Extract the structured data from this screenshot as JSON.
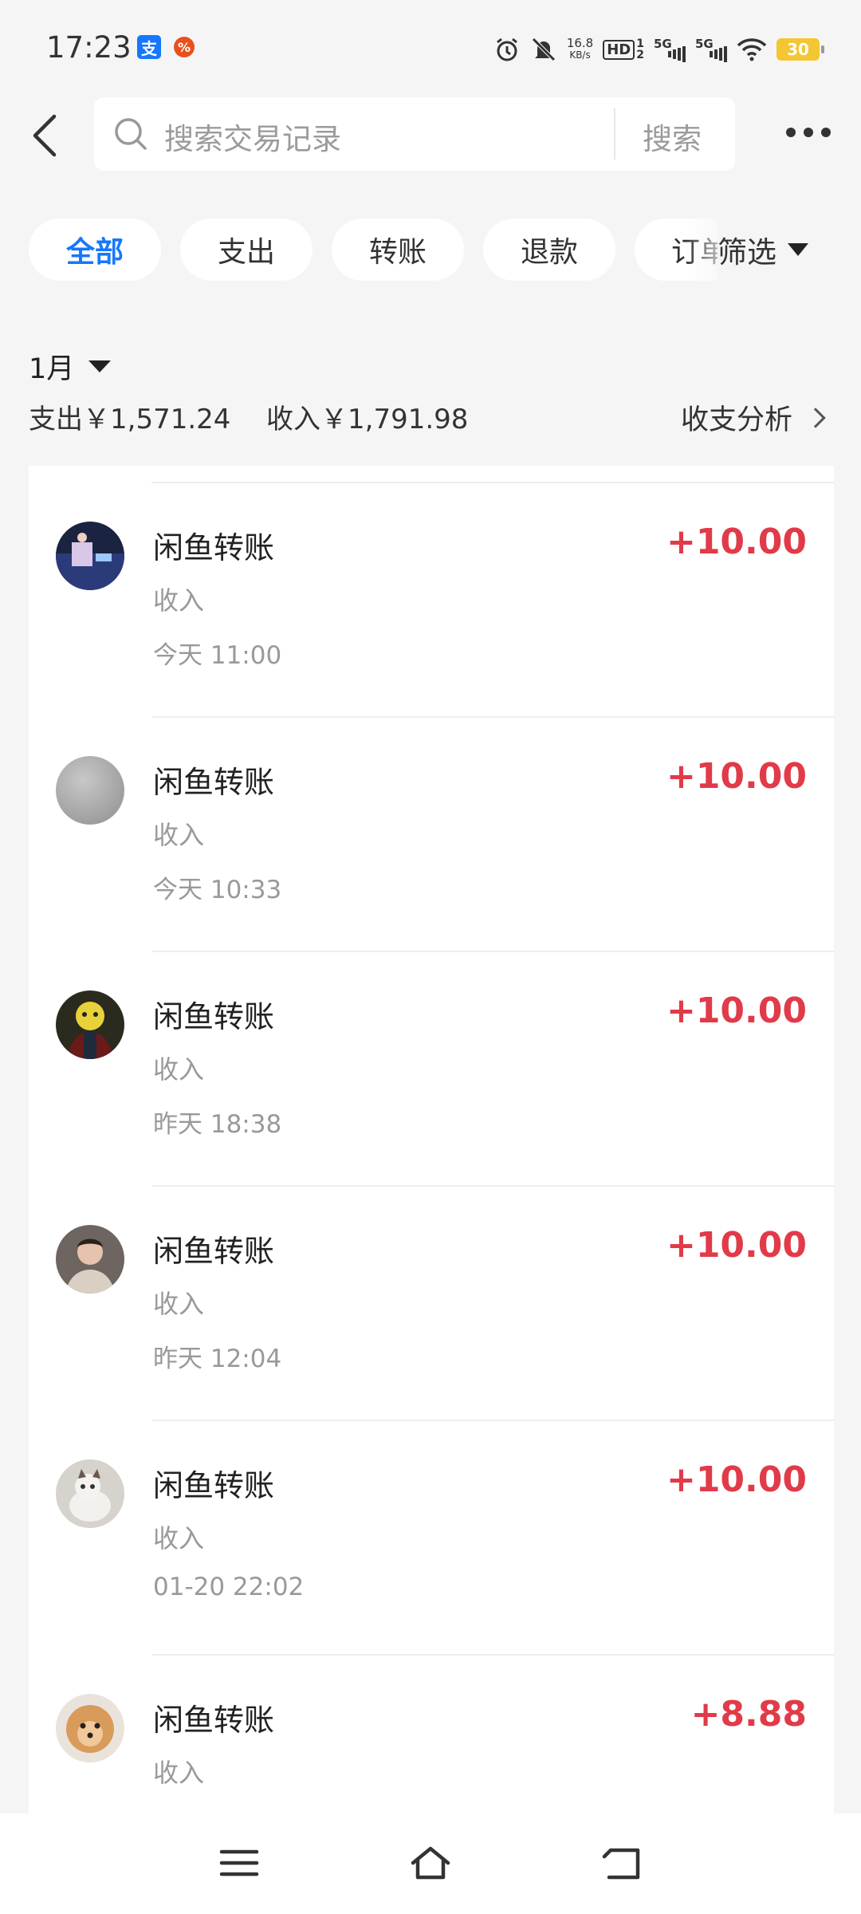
{
  "status": {
    "time": "17:23",
    "apps": [
      {
        "name": "alipay-app-icon",
        "glyph": "支",
        "color": "#1677ff"
      },
      {
        "name": "app-notification-icon",
        "glyph": "%",
        "color": "#e8501d"
      }
    ],
    "net_speed_value": "16.8",
    "net_speed_unit": "KB/s",
    "hd_label": "HD",
    "hd_sub_top": "1",
    "hd_sub_bottom": "2",
    "sim1": "5G",
    "sim2": "5G",
    "battery": "30"
  },
  "search": {
    "placeholder": "搜索交易记录",
    "button": "搜索"
  },
  "tabs": [
    {
      "label": "全部",
      "active": true
    },
    {
      "label": "支出"
    },
    {
      "label": "转账"
    },
    {
      "label": "退款"
    },
    {
      "label": "订单"
    }
  ],
  "filter_label": "筛选",
  "summary": {
    "month": "1月",
    "expense": "支出￥1,571.24",
    "income": "收入￥1,791.98",
    "analysis": "收支分析"
  },
  "transactions": [
    {
      "title": "闲鱼转账",
      "type": "收入",
      "time": "今天 11:00",
      "amount": "+10.00",
      "avatar": "avatar-concert"
    },
    {
      "title": "闲鱼转账",
      "type": "收入",
      "time": "今天 10:33",
      "amount": "+10.00",
      "avatar": "avatar-gray"
    },
    {
      "title": "闲鱼转账",
      "type": "收入",
      "time": "昨天 18:38",
      "amount": "+10.00",
      "avatar": "avatar-character"
    },
    {
      "title": "闲鱼转账",
      "type": "收入",
      "time": "昨天 12:04",
      "amount": "+10.00",
      "avatar": "avatar-person"
    },
    {
      "title": "闲鱼转账",
      "type": "收入",
      "time": "01-20 22:02",
      "amount": "+10.00",
      "avatar": "avatar-cat"
    },
    {
      "title": "闲鱼转账",
      "type": "收入",
      "time": "",
      "amount": "+8.88",
      "avatar": "avatar-dog"
    }
  ],
  "colors": {
    "accent": "#1677ff",
    "income": "#e13a49"
  }
}
